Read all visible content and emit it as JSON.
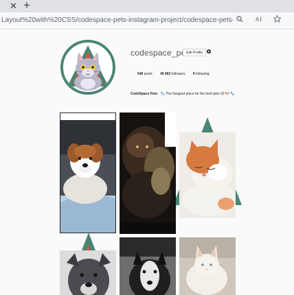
{
  "browser": {
    "close_tab_glyph": "✕",
    "new_tab_glyph": "+",
    "url": "Layout%20with%20CSS/codespace-pets-instagram-project/codespace-pets-instagram-project-...",
    "icons": [
      "search-icon",
      "read-aloud-icon",
      "favorite-icon"
    ]
  },
  "profile": {
    "username": "codespace_pets",
    "edit_label": "Edit Profile",
    "settings_icon": "gear-icon",
    "stats": {
      "posts_count": "549",
      "posts_label": "posts",
      "followers_count": "45 682",
      "followers_label": "followers",
      "following_count": "9",
      "following_label": "following"
    },
    "bio_name": "CodeSpace Pets",
    "bio_text": "The hangout place for the best pets",
    "bio_emojis": "🐱 🐶 🐾",
    "bio_lead_emoji": "🐾"
  },
  "colors": {
    "accent_green": "#4b8473",
    "accent_red": "#d7523f",
    "page_bg": "#fafafa"
  },
  "posts": [
    {
      "subject": "puppy"
    },
    {
      "subject": "tabby-cat"
    },
    {
      "subject": "ginger-cat"
    },
    {
      "subject": "pitbull"
    },
    {
      "subject": "bw-dog"
    },
    {
      "subject": "white-cat"
    }
  ]
}
